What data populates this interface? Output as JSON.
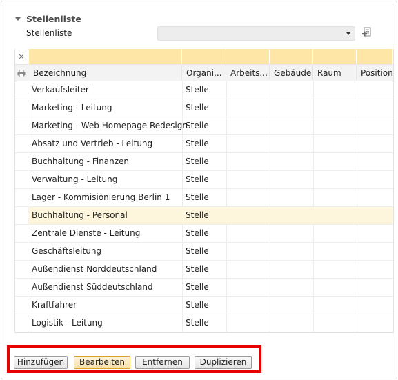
{
  "section": {
    "title": "Stellenliste"
  },
  "field": {
    "label": "Stellenliste",
    "value": ""
  },
  "table": {
    "columns": [
      "Bezeichnung",
      "Organi...",
      "Arbeits...",
      "Gebäude",
      "Raum",
      "Position"
    ],
    "rows": [
      [
        "Verkaufsleiter",
        "Stelle"
      ],
      [
        "Marketing - Leitung",
        "Stelle"
      ],
      [
        "Marketing - Web Homepage Redesign",
        "Stelle"
      ],
      [
        "Absatz und Vertrieb - Leitung",
        "Stelle"
      ],
      [
        "Buchhaltung - Finanzen",
        "Stelle"
      ],
      [
        "Verwaltung - Leitung",
        "Stelle"
      ],
      [
        "Lager - Kommisionierung Berlin 1",
        "Stelle"
      ],
      [
        "Buchhaltung - Personal",
        "Stelle"
      ],
      [
        "Zentrale Dienste - Leitung",
        "Stelle"
      ],
      [
        "Geschäftsleitung",
        "Stelle"
      ],
      [
        "Außendienst Norddeutschland",
        "Stelle"
      ],
      [
        "Außendienst Süddeutschland",
        "Stelle"
      ],
      [
        "Kraftfahrer",
        "Stelle"
      ],
      [
        "Logistik - Leitung",
        "Stelle"
      ]
    ],
    "selected_index": 7
  },
  "buttons": {
    "add": "Hinzufügen",
    "edit": "Bearbeiten",
    "remove": "Entfernen",
    "duplicate": "Duplizieren"
  },
  "colors": {
    "filter_bg": "#fde6a6",
    "selected_row": "#fdf6dc",
    "highlight_border": "#e60000"
  }
}
